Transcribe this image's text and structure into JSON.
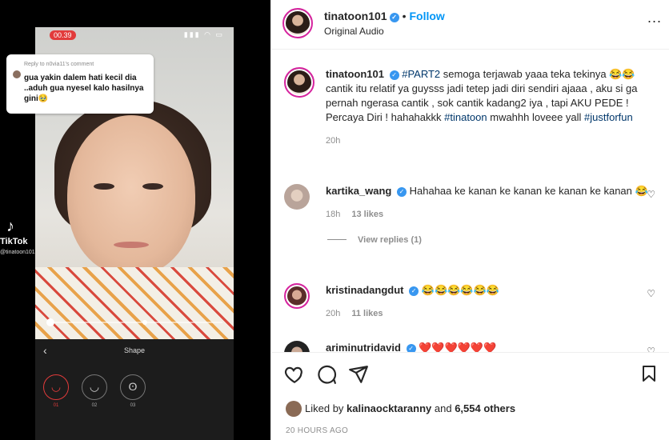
{
  "media": {
    "rec_time": "00.39",
    "reply_header": "Reply to n0via11's comment",
    "reply_text": "gua yakin dalem hati kecil dia ..aduh gua nyesel kalo hasilnya gini🥹",
    "tiktok_brand": "TikTok",
    "tiktok_handle": "@tinatoon101",
    "shape_title": "Shape",
    "shape_options": [
      "01",
      "02",
      "03"
    ]
  },
  "header": {
    "username": "tinatoon101",
    "separator": "•",
    "follow_label": "Follow",
    "audio": "Original Audio",
    "more": "..."
  },
  "caption": {
    "username": "tinatoon101",
    "hashtag_part": "#PART2",
    "text_1": " semoga terjawab yaaa teka tekinya 😂😂 cantik itu relatif ya guysss jadi tetep jadi diri sendiri ajaaa , aku si ga pernah ngerasa cantik , sok cantik kadang2 iya , tapi AKU PEDE ! Percaya Diri ! hahahakkk ",
    "hashtag_tinatoon": "#tinatoon",
    "text_2": " mwahhh loveee yall ",
    "hashtag_justforfun": "#justforfun",
    "time": "20h"
  },
  "comments": [
    {
      "username": "kartika_wang",
      "text": "Hahahaa ke kanan ke kanan ke kanan ke kanan 😂",
      "time": "18h",
      "likes": "13 likes",
      "replies": "View replies (1)"
    },
    {
      "username": "kristinadangdut",
      "text": "😂😂😂😂😂😂",
      "time": "20h",
      "likes": "11 likes"
    },
    {
      "username": "ariminutridavid",
      "text": "❤️❤️❤️❤️❤️❤️"
    }
  ],
  "footer": {
    "liked_prefix": "Liked by ",
    "liked_user": "kalinaocktaranny",
    "liked_mid": " and ",
    "liked_count": "6,554 others",
    "posted": "20 HOURS AGO"
  },
  "colors": {
    "accent": "#0095f6",
    "verified": "#3897f0",
    "hashtag": "#00376b",
    "record": "#e23b3b"
  }
}
